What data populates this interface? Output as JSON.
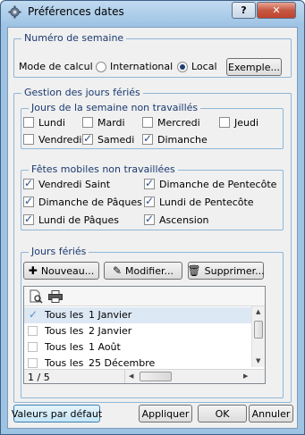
{
  "window": {
    "title": "Préférences dates",
    "help_label": "?",
    "close_label": "✕"
  },
  "week": {
    "legend": "Numéro de semaine",
    "mode_label": "Mode de calcul :",
    "options": [
      {
        "label": "International",
        "selected": false
      },
      {
        "label": "Local",
        "selected": true
      }
    ],
    "example_button": "Exemple..."
  },
  "holidays": {
    "legend": "Gestion des jours fériés",
    "weekdays": {
      "legend": "Jours de la semaine non travaillés",
      "items": [
        {
          "label": "Lundi",
          "checked": false
        },
        {
          "label": "Mardi",
          "checked": false
        },
        {
          "label": "Mercredi",
          "checked": false
        },
        {
          "label": "Jeudi",
          "checked": false
        },
        {
          "label": "Vendredi",
          "checked": false
        },
        {
          "label": "Samedi",
          "checked": true
        },
        {
          "label": "Dimanche",
          "checked": true
        }
      ]
    },
    "mobile": {
      "legend": "Fêtes mobiles non travaillées",
      "items": [
        {
          "label": "Vendredi Saint",
          "checked": true
        },
        {
          "label": "Dimanche de Pentecôte",
          "checked": true
        },
        {
          "label": "Dimanche de Pâques",
          "checked": true
        },
        {
          "label": "Lundi de Pentecôte",
          "checked": true
        },
        {
          "label": "Lundi de Pâques",
          "checked": true
        },
        {
          "label": "Ascension",
          "checked": true
        }
      ]
    },
    "days": {
      "legend": "Jours fériés",
      "new_button": "Nouveau...",
      "edit_button": "Modifier...",
      "delete_button": "Supprimer...",
      "rows": [
        {
          "freq": "Tous les",
          "date": "1 Janvier",
          "checked": true
        },
        {
          "freq": "Tous les",
          "date": "2 Janvier",
          "checked": false
        },
        {
          "freq": "Tous les",
          "date": "1 Août",
          "checked": false
        },
        {
          "freq": "Tous les",
          "date": "25 Décembre",
          "checked": false
        }
      ],
      "pager": "1 / 5"
    }
  },
  "footer": {
    "defaults_button": "Valeurs par défaut",
    "apply_button": "Appliquer",
    "ok_button": "OK",
    "cancel_button": "Annuler"
  }
}
